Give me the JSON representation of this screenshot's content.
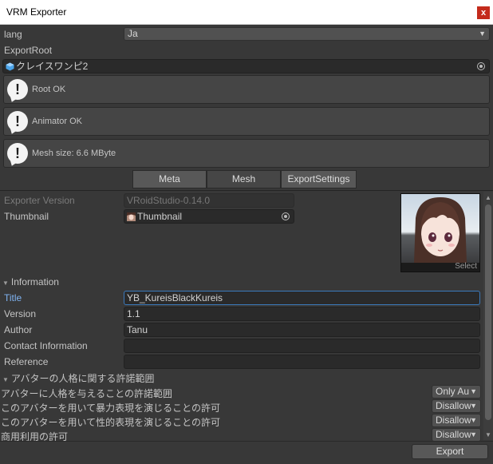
{
  "window": {
    "title": "VRM Exporter",
    "close_glyph": "x"
  },
  "lang": {
    "label": "lang",
    "value": "Ja"
  },
  "export_root": {
    "label": "ExportRoot",
    "value": "クレイスワンピ2"
  },
  "messages": [
    "Root OK",
    "Animator OK",
    "Mesh size: 6.6 MByte"
  ],
  "tabs": [
    {
      "label": "Meta",
      "active": false
    },
    {
      "label": "Mesh",
      "active": true
    },
    {
      "label": "ExportSettings",
      "active": false
    }
  ],
  "meta": {
    "exporter_version_label": "Exporter Version",
    "exporter_version_value": "VRoidStudio-0.14.0",
    "thumbnail_label": "Thumbnail",
    "thumbnail_value": "Thumbnail",
    "thumbnail_select": "Select"
  },
  "information": {
    "header": "Information",
    "fields": [
      {
        "label": "Title",
        "value": "YB_KureisBlackKureis"
      },
      {
        "label": "Version",
        "value": "1.1"
      },
      {
        "label": "Author",
        "value": "Tanu"
      },
      {
        "label": "Contact Information",
        "value": ""
      },
      {
        "label": "Reference",
        "value": ""
      }
    ]
  },
  "permissions": {
    "header": "アバターの人格に関する許諾範囲",
    "items": [
      {
        "label": "アバターに人格を与えることの許諾範囲",
        "value": "Only Au"
      },
      {
        "label": "このアバターを用いて暴力表現を演じることの許可",
        "value": "Disallow"
      },
      {
        "label": "このアバターを用いて性的表現を演じることの許可",
        "value": "Disallow"
      },
      {
        "label": "商用利用の許可",
        "value": "Disallow"
      }
    ]
  },
  "export_button": "Export",
  "icons": [
    "close-icon",
    "dropdown-arrow-icon",
    "vrm-object-icon",
    "object-picker-icon",
    "warning-icon",
    "collapse-triangle-icon",
    "scroll-up-icon",
    "scroll-down-icon"
  ]
}
